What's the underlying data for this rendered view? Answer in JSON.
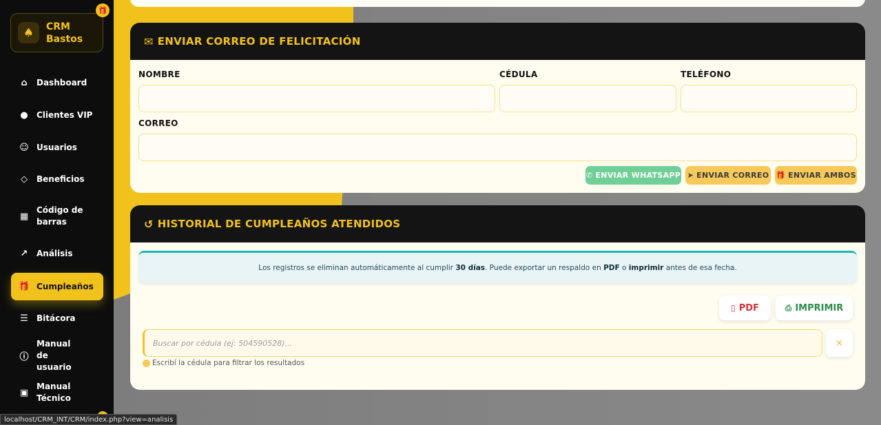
{
  "app": {
    "name_line1": "CRM",
    "name_line2": "Bastos"
  },
  "sidebar": {
    "items": [
      {
        "label": "Dashboard",
        "icon": "home-icon"
      },
      {
        "label": "Clientes VIP",
        "icon": "vip-icon"
      },
      {
        "label": "Usuarios",
        "icon": "user-icon"
      },
      {
        "label": "Beneficios",
        "icon": "tag-icon"
      },
      {
        "label": "Código de barras",
        "icon": "barcode-icon"
      },
      {
        "label": "Análisis",
        "icon": "chart-line-icon"
      },
      {
        "label": "Cumpleaños",
        "icon": "gift-icon",
        "active": true
      },
      {
        "label": "Bitácora",
        "icon": "log-icon"
      },
      {
        "label": "Manual de usuario",
        "icon": "info-icon"
      },
      {
        "label": "Manual Técnico",
        "icon": "tech-manual-icon"
      }
    ]
  },
  "send_card": {
    "title": "ENVIAR CORREO DE FELICITACIÓN",
    "fields": {
      "nombre": {
        "label": "NOMBRE",
        "value": ""
      },
      "cedula": {
        "label": "CÉDULA",
        "value": ""
      },
      "telefono": {
        "label": "TELÉFONO",
        "value": ""
      },
      "correo": {
        "label": "CORREO",
        "value": ""
      }
    },
    "buttons": {
      "whatsapp": "ENVIAR WHATSAPP",
      "correo": "ENVIAR CORREO",
      "ambos": "ENVIAR AMBOS"
    }
  },
  "history_card": {
    "title": "HISTORIAL DE CUMPLEAÑOS ATENDIDOS",
    "info": {
      "part1": "Los registros se eliminan automáticamente al cumplir ",
      "days": "30 días",
      "part2": ". Puede exportar un respaldo en ",
      "pdf": "PDF",
      "part3": " o ",
      "print": "imprimir",
      "part4": " antes de esa fecha."
    },
    "export": {
      "pdf": "PDF",
      "print": "IMPRIMIR"
    },
    "search": {
      "placeholder": "Buscar por cédula (ej: 504590528)...",
      "clear": "×",
      "hint": "Escribí la cédula para filtrar los resultados"
    }
  },
  "status_bar": {
    "url": "localhost/CRM_INT/CRM/index.php?view=analisis"
  },
  "colors": {
    "accent": "#f2c21c",
    "sidebar_bg": "#0d0d0d",
    "header_bg": "#141414",
    "whatsapp": "#6fcf97",
    "pdf": "#d6333a",
    "print": "#2e8b4a"
  }
}
